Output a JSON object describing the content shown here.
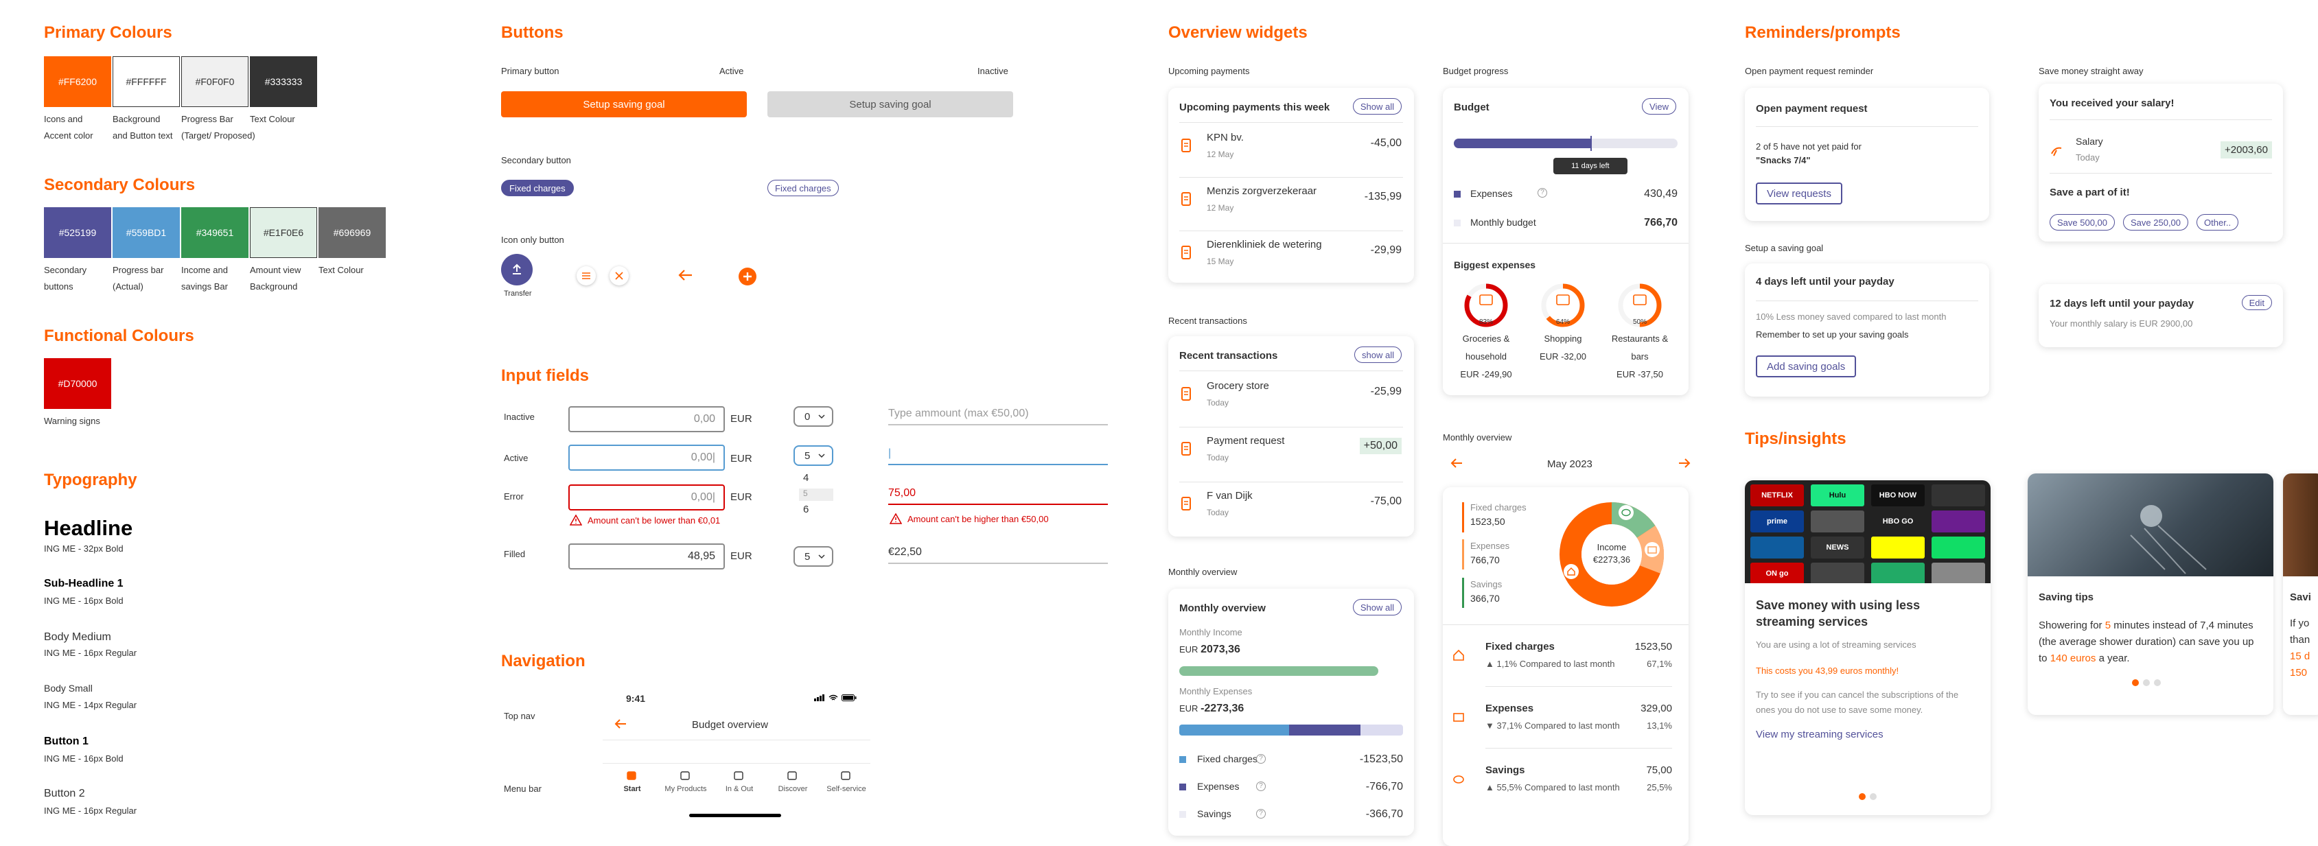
{
  "colors": {
    "orange": "#FF6200",
    "white": "#FFFFFF",
    "light": "#F0F0F0",
    "text": "#333333",
    "purple": "#525199",
    "blue": "#559BD1",
    "green": "#349651",
    "mint": "#E1F0E6",
    "grey": "#696969",
    "red": "#D70000"
  },
  "primary": {
    "title": "Primary Colours",
    "swatches": [
      {
        "hex": "#FF6200",
        "l1": "Icons and",
        "l2": "Accent color"
      },
      {
        "hex": "#FFFFFF",
        "l1": "Background",
        "l2": "and Button text"
      },
      {
        "hex": "#F0F0F0",
        "l1": "Progress Bar",
        "l2": "(Target/ Proposed)"
      },
      {
        "hex": "#333333",
        "l1": "Text Colour",
        "l2": ""
      }
    ]
  },
  "secondary": {
    "title": "Secondary Colours",
    "swatches": [
      {
        "hex": "#525199",
        "l1": "Secondary",
        "l2": "buttons"
      },
      {
        "hex": "#559BD1",
        "l1": "Progress bar",
        "l2": "(Actual)"
      },
      {
        "hex": "#349651",
        "l1": "Income and",
        "l2": "savings Bar"
      },
      {
        "hex": "#E1F0E6",
        "l1": "Amount view",
        "l2": "Background"
      },
      {
        "hex": "#696969",
        "l1": "Text Colour",
        "l2": ""
      }
    ]
  },
  "functional": {
    "title": "Functional Colours",
    "swatches": [
      {
        "hex": "#D70000",
        "l1": "Warning signs",
        "l2": ""
      }
    ]
  },
  "typography": {
    "title": "Typography",
    "items": [
      {
        "name": "Headline",
        "spec": "ING ME - 32px Bold"
      },
      {
        "name": "Sub-Headline 1",
        "spec": "ING ME - 16px Bold"
      },
      {
        "name": "Body Medium",
        "spec": "ING ME - 16px Regular"
      },
      {
        "name": "Body Small",
        "spec": "ING ME - 14px Regular"
      },
      {
        "name": "Button 1",
        "spec": "ING ME - 16px Bold"
      },
      {
        "name": "Button 2",
        "spec": "ING ME - 16px Regular"
      }
    ]
  },
  "buttons": {
    "title": "Buttons",
    "primary_label": "Primary button",
    "active": "Active",
    "inactive": "Inactive",
    "setup": "Setup saving goal",
    "secondary_label": "Secondary button",
    "fixed": "Fixed charges",
    "icon_label": "Icon only button",
    "transfer": "Transfer"
  },
  "inputs": {
    "title": "Input fields",
    "inactive": "Inactive",
    "active": "Active",
    "error": "Error",
    "filled": "Filled",
    "zero": "0,00",
    "zero_cursor": "0,00|",
    "filled_val": "48,95",
    "eur": "EUR",
    "dd0": "0",
    "dd5": "5",
    "opt4": "4",
    "opt5": "5",
    "opt6": "6",
    "placeholder": "Type ammount (max €50,00)",
    "cursor": "|",
    "err_val": "75,00",
    "err_low": "Amount can't be lower than €0,01",
    "err_high": "Amount can't be higher than €50,00",
    "filled2": "€22,50"
  },
  "navigation": {
    "title": "Navigation",
    "top": "Top nav",
    "menu": "Menu bar",
    "time": "9:41",
    "page": "Budget overview",
    "tabs": [
      "Start",
      "My Products",
      "In & Out",
      "Discover",
      "Self-service"
    ]
  },
  "overview": {
    "title": "Overview widgets",
    "upcoming_label": "Upcoming payments",
    "upcoming": {
      "title": "Upcoming payments this week",
      "show": "Show all",
      "rows": [
        {
          "name": "KPN bv.",
          "date": "12 May",
          "amt": "-45,00"
        },
        {
          "name": "Menzis zorgverzekeraar",
          "date": "12 May",
          "amt": "-135,99"
        },
        {
          "name": "Dierenkliniek de wetering",
          "date": "15 May",
          "amt": "-29,99"
        }
      ]
    },
    "recent_label": "Recent transactions",
    "recent": {
      "title": "Recent transactions",
      "show": "show all",
      "rows": [
        {
          "name": "Grocery store",
          "date": "Today",
          "amt": "-25,99"
        },
        {
          "name": "Payment request",
          "date": "Today",
          "amt": "+50,00"
        },
        {
          "name": "F van Dijk",
          "date": "Today",
          "amt": "-75,00"
        }
      ]
    },
    "monthly_label": "Monthly overview",
    "monthly": {
      "title": "Monthly overview",
      "show": "Show all",
      "inc_label": "Monthly Income",
      "inc_cur": "EUR",
      "inc": "2073,36",
      "exp_label": "Monthly Expenses",
      "exp_cur": "EUR",
      "exp": "-2273,36",
      "rows": [
        {
          "name": "Fixed charges",
          "amt": "-1523,50"
        },
        {
          "name": "Expenses",
          "amt": "-766,70"
        },
        {
          "name": "Savings",
          "amt": "-366,70"
        }
      ]
    },
    "budget_label": "Budget progress",
    "budget": {
      "title": "Budget",
      "view": "View",
      "progress": 0.61,
      "tooltip": "11 days left",
      "exp_label": "Expenses",
      "exp": "430,49",
      "mb_label": "Monthly budget",
      "mb": "766,70",
      "big": "Biggest expenses",
      "cats": [
        {
          "pct": "83%",
          "l1": "Groceries &",
          "l2": "household",
          "amt": "EUR -249,90",
          "v": 0.83
        },
        {
          "pct": "64%",
          "l1": "Shopping",
          "l2": "",
          "amt": "EUR -32,00",
          "v": 0.64
        },
        {
          "pct": "50%",
          "l1": "Restaurants &",
          "l2": "bars",
          "amt": "EUR -37,50",
          "v": 0.5
        }
      ]
    },
    "mo_label": "Monthly overview",
    "mo": {
      "month": "May 2023",
      "fixed": "Fixed charges",
      "fixed_v": "1523,50",
      "exp": "Expenses",
      "exp_v": "766,70",
      "sav": "Savings",
      "sav_v": "366,70",
      "income": "Income",
      "income_v": "€2273,36",
      "rows": [
        {
          "name": "Fixed charges",
          "amt": "1523,50",
          "delta": "▲ 1,1% Compared to last month",
          "pct": "67,1%"
        },
        {
          "name": "Expenses",
          "amt": "329,00",
          "delta": "▼ 37,1% Compared to last month",
          "pct": "13,1%"
        },
        {
          "name": "Savings",
          "amt": "75,00",
          "delta": "▲ 55,5% Compared to last month",
          "pct": "25,5%"
        }
      ]
    }
  },
  "reminders": {
    "title": "Reminders/prompts",
    "open_label": "Open payment request reminder",
    "open": {
      "title": "Open payment request",
      "line": "2 of 5 have not yet paid for",
      "item": "\"Snacks 7/4\"",
      "btn": "View requests"
    },
    "save_label": "Save money straight away",
    "save": {
      "title": "You received your salary!",
      "name": "Salary",
      "date": "Today",
      "amt": "+2003,60",
      "part": "Save a part of it!",
      "opts": [
        "Save 500,00",
        "Save 250,00",
        "Other.."
      ]
    },
    "goal_label": "Setup a saving goal",
    "goal": {
      "title": "4 days left until your payday",
      "l1": "10% Less money saved compared to last month",
      "l2": "Remember to set up your saving goals",
      "btn": "Add saving goals"
    },
    "payday": {
      "title": "12 days left until your payday",
      "edit": "Edit",
      "line": "Your monthly salary is EUR 2900,00"
    }
  },
  "tips": {
    "title": "Tips/insights",
    "c1": {
      "title": "Save money with using less streaming services",
      "l1": "You are using a lot of streaming services",
      "l2": "This costs you 43,99 euros monthly!",
      "l3": "Try to see if you can cancel the subscriptions of the ones you do not use to save some money.",
      "link": "View my streaming services",
      "tiles": [
        "NETFLIX",
        "Hulu",
        "HBO NOW",
        "",
        "prime",
        "",
        "HBO GO",
        "",
        "",
        "NEWS",
        "",
        "",
        "ON go",
        "",
        "",
        ""
      ]
    },
    "c2": {
      "title": "Saving tips",
      "pre": "Showering for ",
      "n5": "5",
      "mid": " minutes instead of 7,4 minutes (the average shower duration) can save you up to ",
      "e140": "140 euros",
      "post": " a year."
    },
    "c3": {
      "title": "Savi",
      "l1": "If yo",
      "l2": "than",
      "l3": "15 d",
      "l4": "150"
    }
  }
}
